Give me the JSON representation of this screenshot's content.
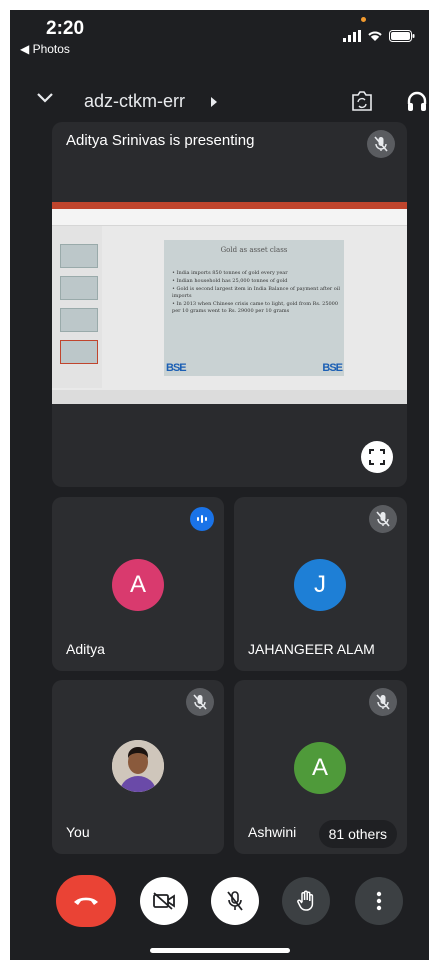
{
  "status_bar": {
    "time": "2:20",
    "back_label": "◀ Photos"
  },
  "header": {
    "meeting_code": "adz-ctkm-err"
  },
  "presenter": {
    "label": "Aditya Srinivas is presenting",
    "slide": {
      "title": "Gold as asset class",
      "bullets": [
        "India imports 850 tonnes of gold every year",
        "Indian household has 25,000 tonnes of gold",
        "Gold is second largest item in India Balance of payment after oil imports",
        "In 2013 when Chinese crisis came to light, gold from Rs. 25000 per 10 grams went to Rs. 29000 per 10 grams"
      ],
      "logo_text": "BSE"
    }
  },
  "participants": [
    {
      "name": "Aditya",
      "initial": "A",
      "color": "#d93a6e",
      "speaking": true
    },
    {
      "name": "JAHANGEER ALAM",
      "initial": "J",
      "color": "#1e7fd6",
      "speaking": false
    },
    {
      "name": "You",
      "initial": "",
      "color": "#d6d0c8",
      "speaking": false
    },
    {
      "name": "Ashwini",
      "initial": "A",
      "color": "#4f9a3a",
      "speaking": false
    }
  ],
  "others_count_label": "81 others",
  "colors": {
    "end_call": "#ea4335",
    "speaking": "#1a73e8",
    "background": "#1e1f22"
  }
}
